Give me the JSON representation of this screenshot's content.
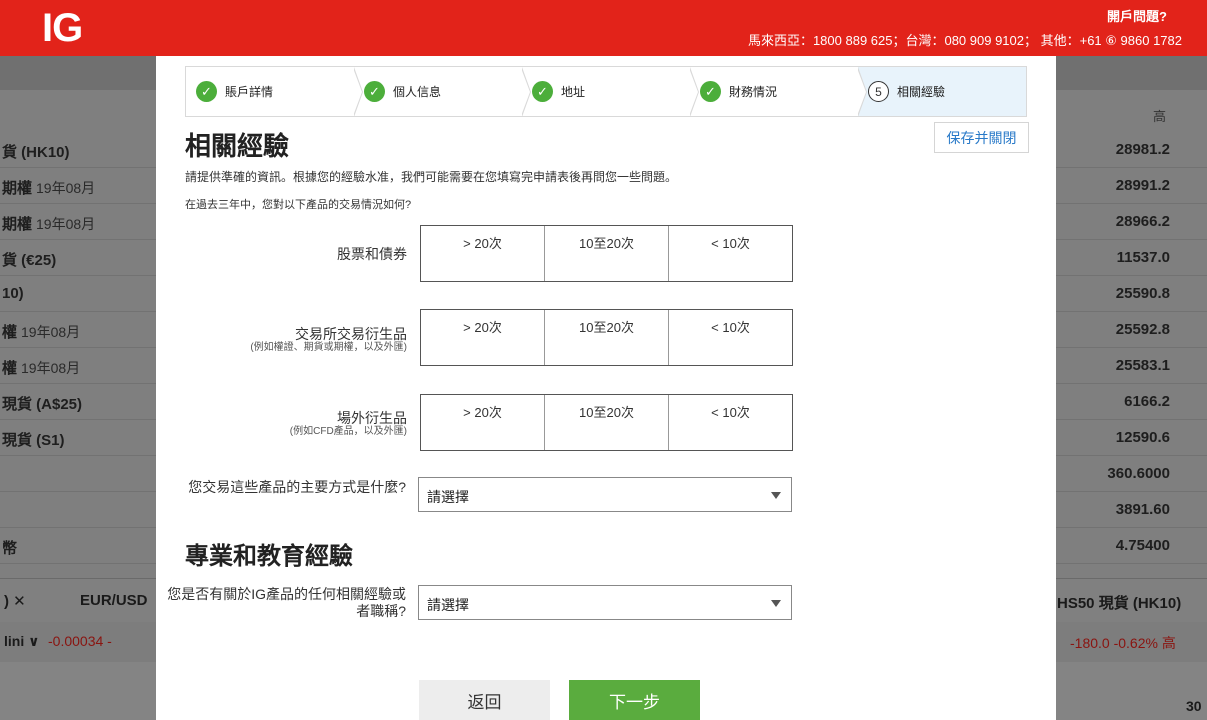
{
  "header": {
    "logo": "IG",
    "help_title": "開戶問題?",
    "help_phones": "馬來西亞：1800 889 625；台灣：080 909 9102； 其他：+61 ⑥ 9860 1782"
  },
  "background": {
    "col_title": "高",
    "rows": [
      {
        "label": "貨 (HK10)",
        "sub": "",
        "value": "28981.2"
      },
      {
        "label": "期權",
        "sub": "19年08月",
        "value": "28991.2"
      },
      {
        "label": "期權",
        "sub": "19年08月",
        "value": "28966.2"
      },
      {
        "label": "貨 (€25)",
        "sub": "",
        "value": "11537.0"
      },
      {
        "label": "10)",
        "sub": "",
        "value": "25590.8"
      },
      {
        "label": "權",
        "sub": "19年08月",
        "value": "25592.8"
      },
      {
        "label": "權",
        "sub": "19年08月",
        "value": "25583.1"
      },
      {
        "label": "現貨 (A$25)",
        "sub": "",
        "value": "6166.2"
      },
      {
        "label": "現貨 (S1)",
        "sub": "",
        "value": "12590.6"
      },
      {
        "label": "",
        "sub": "",
        "value": "360.6000"
      },
      {
        "label": "",
        "sub": "",
        "value": "3891.60"
      },
      {
        "label": "幣",
        "sub": "",
        "value": "4.75400"
      }
    ],
    "tabs": {
      "t1": ") ✕",
      "t2": "EUR/USD",
      "t3": "HS50 現貨 (HK10)"
    },
    "ticker": {
      "a": "lini ∨",
      "b": "-0.00034 -",
      "c": "-180.0 -0.62% 高"
    },
    "bottom_num": "30"
  },
  "steps": [
    {
      "label": "賬戶詳情",
      "status": "done"
    },
    {
      "label": "個人信息",
      "status": "done"
    },
    {
      "label": "地址",
      "status": "done"
    },
    {
      "label": "財務情況",
      "status": "done"
    },
    {
      "label": "相關經驗",
      "status": "active",
      "number": "5"
    }
  ],
  "save_close_label": "保存并關閉",
  "section1": {
    "title": "相關經驗",
    "intro": "請提供準確的資訊。根據您的經驗水准，我們可能需要在您填寫完申請表後再問您一些問題。",
    "question": "在過去三年中，您對以下產品的交易情況如何?"
  },
  "products": [
    {
      "label": "股票和債券",
      "note": "",
      "options": [
        "> 20次",
        "10至20次",
        "< 10次"
      ]
    },
    {
      "label": "交易所交易衍生品",
      "note": "(例如權證、期貨或期權，以及外匯)",
      "options": [
        "> 20次",
        "10至20次",
        "< 10次"
      ]
    },
    {
      "label": "場外衍生品",
      "note": "(例如CFD產品，以及外匯)",
      "options": [
        "> 20次",
        "10至20次",
        "< 10次"
      ]
    }
  ],
  "trading_method": {
    "label": "您交易這些產品的主要方式是什麼?",
    "value": "請選擇"
  },
  "section2": {
    "title": "專業和教育經驗"
  },
  "ig_experience": {
    "label": "您是否有關於IG產品的任何相關經驗或者職稱?",
    "value": "請選擇"
  },
  "buttons": {
    "back": "返回",
    "next": "下一步"
  },
  "colors": {
    "brand_red": "#e2231a",
    "success_green": "#5aac3e",
    "link_blue": "#2879c8"
  }
}
